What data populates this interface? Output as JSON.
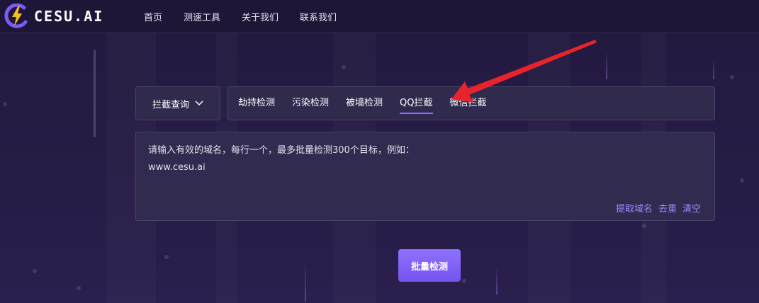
{
  "brand": {
    "name": "CESU.AI"
  },
  "nav": {
    "items": [
      {
        "label": "首页"
      },
      {
        "label": "测速工具"
      },
      {
        "label": "关于我们"
      },
      {
        "label": "联系我们"
      }
    ]
  },
  "query_select": {
    "value": "拦截查询",
    "icon": "chevron-down-icon"
  },
  "tabs": {
    "items": [
      {
        "label": "劫持检测"
      },
      {
        "label": "污染检测"
      },
      {
        "label": "被墙检测"
      },
      {
        "label": "QQ拦截",
        "active": true
      },
      {
        "label": "微信拦截"
      }
    ]
  },
  "domain_input": {
    "placeholder": "请输入有效的域名，每行一个，最多批量检测300个目标，例如：\nwww.cesu.ai",
    "value": ""
  },
  "input_actions": {
    "extract": "提取域名",
    "dedupe": "去重",
    "clear": "清空"
  },
  "submit": {
    "label": "批量检测"
  },
  "colors": {
    "accent": "#8a6cff",
    "link": "#9f86ff",
    "arrow": "#e8232b",
    "logo_yellow": "#f2c01e"
  }
}
